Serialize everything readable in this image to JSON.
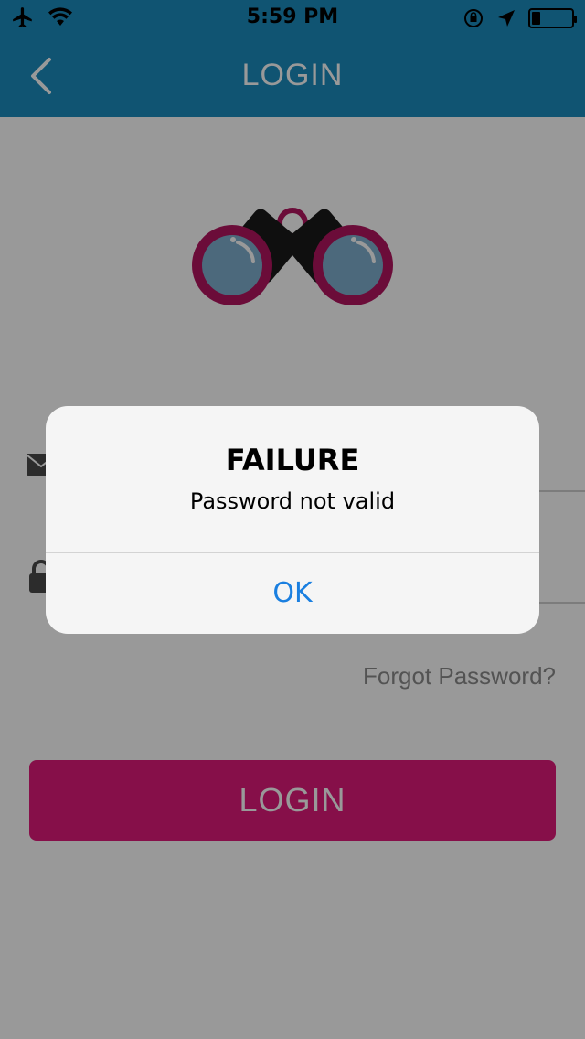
{
  "status_bar": {
    "time": "5:59 PM",
    "battery_level": 0.22,
    "icons": [
      "airplane-icon",
      "wifi-icon",
      "orientation-lock-icon",
      "location-icon",
      "battery-icon"
    ]
  },
  "nav": {
    "title": "LOGIN",
    "back_icon": "chevron-left-icon"
  },
  "login_form": {
    "email_icon": "envelope-icon",
    "password_icon": "lock-icon",
    "email_value": "",
    "password_value": "",
    "forgot_label": "Forgot Password?",
    "login_label": "LOGIN"
  },
  "alert": {
    "title": "FAILURE",
    "message": "Password not valid",
    "ok_label": "OK"
  },
  "colors": {
    "header": "#1c8cbf",
    "brand": "#e0197a",
    "alert_button": "#1a7fe0",
    "logo_ring": "#b3155f",
    "logo_lens": "#7fb0cf"
  }
}
